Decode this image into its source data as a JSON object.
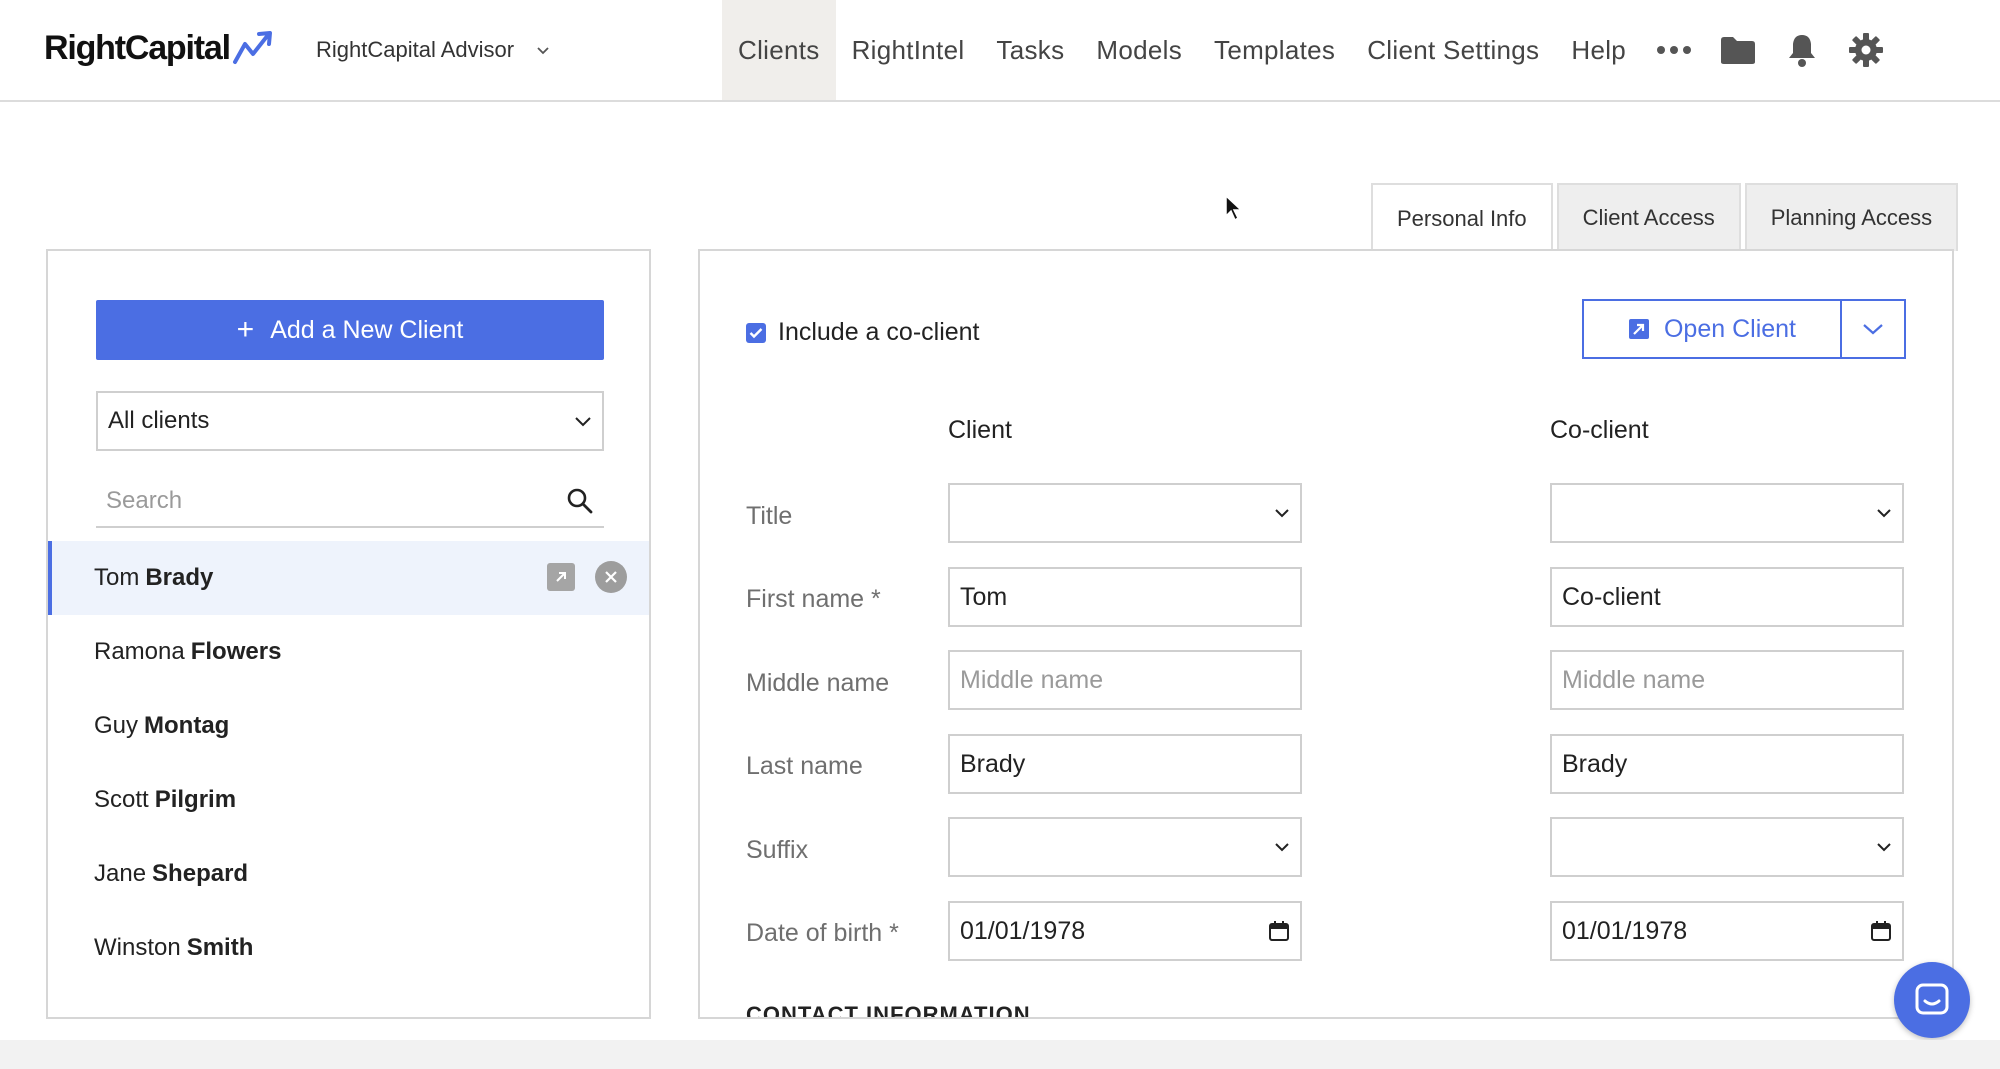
{
  "header": {
    "logo_text": "RightCapital",
    "account_name": "RightCapital Advisor",
    "nav": [
      {
        "label": "Clients",
        "active": true
      },
      {
        "label": "RightIntel",
        "active": false
      },
      {
        "label": "Tasks",
        "active": false
      },
      {
        "label": "Models",
        "active": false
      },
      {
        "label": "Templates",
        "active": false
      },
      {
        "label": "Client Settings",
        "active": false
      },
      {
        "label": "Help",
        "active": false
      }
    ],
    "icons": [
      "more-icon",
      "folder-icon",
      "bell-icon",
      "gear-icon"
    ]
  },
  "tabs": [
    {
      "label": "Personal Info",
      "active": true
    },
    {
      "label": "Client Access",
      "active": false
    },
    {
      "label": "Planning Access",
      "active": false
    }
  ],
  "sidebar": {
    "add_button": "Add a New Client",
    "filter_value": "All clients",
    "search_placeholder": "Search",
    "clients": [
      {
        "first": "Tom",
        "last": "Brady",
        "selected": true
      },
      {
        "first": "Ramona",
        "last": "Flowers",
        "selected": false
      },
      {
        "first": "Guy",
        "last": "Montag",
        "selected": false
      },
      {
        "first": "Scott",
        "last": "Pilgrim",
        "selected": false
      },
      {
        "first": "Jane",
        "last": "Shepard",
        "selected": false
      },
      {
        "first": "Winston",
        "last": "Smith",
        "selected": false
      }
    ]
  },
  "form": {
    "include_coclient": "Include a co-client",
    "open_client": "Open Client",
    "col_client": "Client",
    "col_coclient": "Co-client",
    "labels": {
      "title": "Title",
      "first_name": "First name *",
      "middle_name": "Middle name",
      "last_name": "Last name",
      "suffix": "Suffix",
      "dob": "Date of birth *"
    },
    "client": {
      "title": "",
      "first_name": "Tom",
      "middle_name_placeholder": "Middle name",
      "last_name": "Brady",
      "suffix": "",
      "dob": "01/01/1978"
    },
    "coclient": {
      "title": "",
      "first_name": "Co-client",
      "middle_name_placeholder": "Middle name",
      "last_name": "Brady",
      "suffix": "",
      "dob": "01/01/1978"
    },
    "section_contact": "CONTACT INFORMATION"
  },
  "colors": {
    "accent": "#4b6ee3",
    "selected_row": "#eef3fc",
    "nav_active": "#f0eeeb"
  }
}
